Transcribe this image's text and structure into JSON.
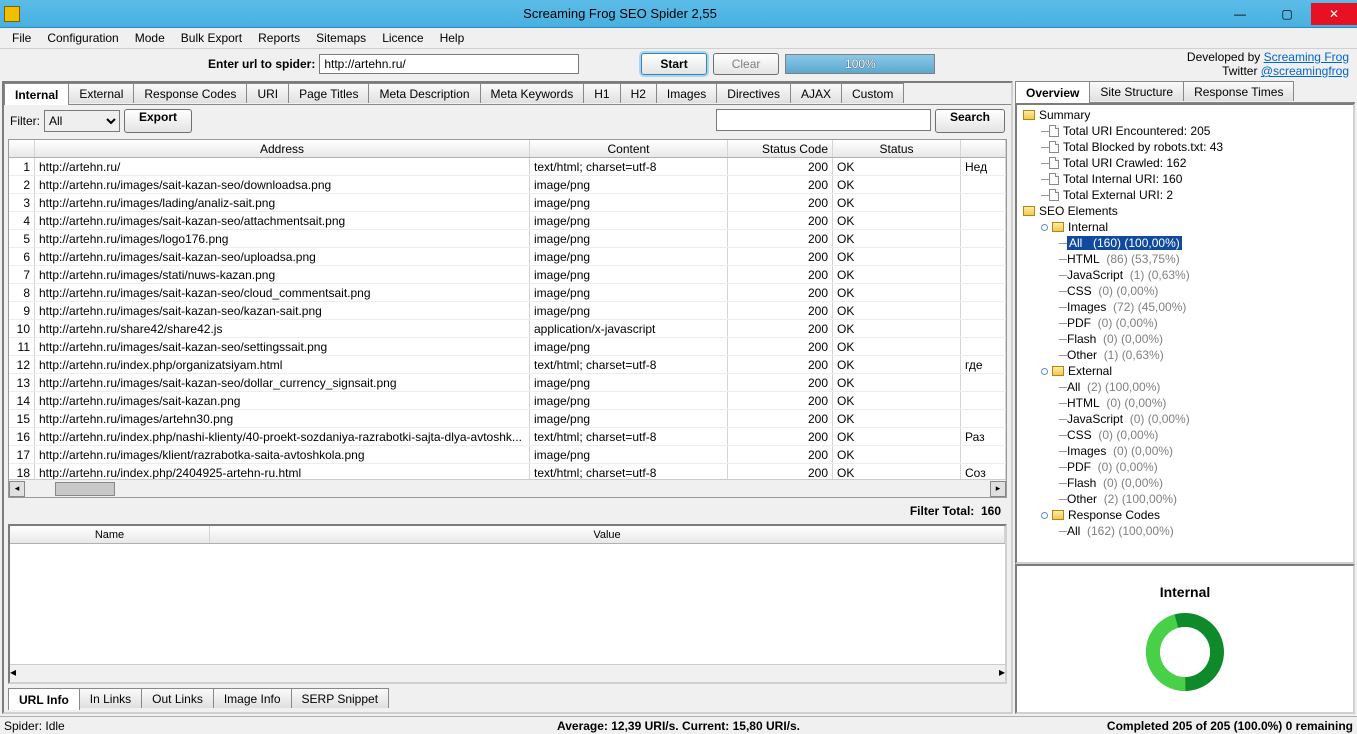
{
  "window": {
    "title": "Screaming Frog SEO Spider 2,55"
  },
  "menu": [
    "File",
    "Configuration",
    "Mode",
    "Bulk Export",
    "Reports",
    "Sitemaps",
    "Licence",
    "Help"
  ],
  "urlbar": {
    "label": "Enter url to spider:",
    "value": "http://artehn.ru/",
    "start": "Start",
    "clear": "Clear",
    "progress": "100%"
  },
  "credits": {
    "line1_prefix": "Developed by ",
    "line1_link": "Screaming Frog",
    "line2_prefix": "Twitter ",
    "line2_link": "@screamingfrog"
  },
  "main_tabs": [
    "Internal",
    "External",
    "Response Codes",
    "URI",
    "Page Titles",
    "Meta Description",
    "Meta Keywords",
    "H1",
    "H2",
    "Images",
    "Directives",
    "AJAX",
    "Custom"
  ],
  "filter": {
    "label": "Filter:",
    "value": "All",
    "export": "Export",
    "search": "Search"
  },
  "table": {
    "headers": [
      "",
      "Address",
      "Content",
      "Status Code",
      "Status",
      ""
    ],
    "rows": [
      {
        "n": "1",
        "addr": "http://artehn.ru/",
        "content": "text/html; charset=utf-8",
        "code": "200",
        "status": "OK",
        "extra": "Нед"
      },
      {
        "n": "2",
        "addr": "http://artehn.ru/images/sait-kazan-seo/downloadsa.png",
        "content": "image/png",
        "code": "200",
        "status": "OK",
        "extra": ""
      },
      {
        "n": "3",
        "addr": "http://artehn.ru/images/lading/analiz-sait.png",
        "content": "image/png",
        "code": "200",
        "status": "OK",
        "extra": ""
      },
      {
        "n": "4",
        "addr": "http://artehn.ru/images/sait-kazan-seo/attachmentsait.png",
        "content": "image/png",
        "code": "200",
        "status": "OK",
        "extra": ""
      },
      {
        "n": "5",
        "addr": "http://artehn.ru/images/logo176.png",
        "content": "image/png",
        "code": "200",
        "status": "OK",
        "extra": ""
      },
      {
        "n": "6",
        "addr": "http://artehn.ru/images/sait-kazan-seo/uploadsa.png",
        "content": "image/png",
        "code": "200",
        "status": "OK",
        "extra": ""
      },
      {
        "n": "7",
        "addr": "http://artehn.ru/images/stati/nuws-kazan.png",
        "content": "image/png",
        "code": "200",
        "status": "OK",
        "extra": ""
      },
      {
        "n": "8",
        "addr": "http://artehn.ru/images/sait-kazan-seo/cloud_commentsait.png",
        "content": "image/png",
        "code": "200",
        "status": "OK",
        "extra": ""
      },
      {
        "n": "9",
        "addr": "http://artehn.ru/images/sait-kazan-seo/kazan-sait.png",
        "content": "image/png",
        "code": "200",
        "status": "OK",
        "extra": ""
      },
      {
        "n": "10",
        "addr": "http://artehn.ru/share42/share42.js",
        "content": "application/x-javascript",
        "code": "200",
        "status": "OK",
        "extra": ""
      },
      {
        "n": "11",
        "addr": "http://artehn.ru/images/sait-kazan-seo/settingssait.png",
        "content": "image/png",
        "code": "200",
        "status": "OK",
        "extra": ""
      },
      {
        "n": "12",
        "addr": "http://artehn.ru/index.php/organizatsiyam.html",
        "content": "text/html; charset=utf-8",
        "code": "200",
        "status": "OK",
        "extra": "где"
      },
      {
        "n": "13",
        "addr": "http://artehn.ru/images/sait-kazan-seo/dollar_currency_signsait.png",
        "content": "image/png",
        "code": "200",
        "status": "OK",
        "extra": ""
      },
      {
        "n": "14",
        "addr": "http://artehn.ru/images/sait-kazan.png",
        "content": "image/png",
        "code": "200",
        "status": "OK",
        "extra": ""
      },
      {
        "n": "15",
        "addr": "http://artehn.ru/images/artehn30.png",
        "content": "image/png",
        "code": "200",
        "status": "OK",
        "extra": ""
      },
      {
        "n": "16",
        "addr": "http://artehn.ru/index.php/nashi-klienty/40-proekt-sozdaniya-razrabotki-sajta-dlya-avtoshk...",
        "content": "text/html; charset=utf-8",
        "code": "200",
        "status": "OK",
        "extra": "Раз"
      },
      {
        "n": "17",
        "addr": "http://artehn.ru/images/klient/razrabotka-saita-avtoshkola.png",
        "content": "image/png",
        "code": "200",
        "status": "OK",
        "extra": ""
      },
      {
        "n": "18",
        "addr": "http://artehn.ru/index.php/2404925-artehn-ru.html",
        "content": "text/html; charset=utf-8",
        "code": "200",
        "status": "OK",
        "extra": "Соз"
      }
    ]
  },
  "filter_total_label": "Filter Total:",
  "filter_total_value": "160",
  "detail": {
    "cols": [
      "Name",
      "Value"
    ],
    "tabs": [
      "URL Info",
      "In Links",
      "Out Links",
      "Image Info",
      "SERP Snippet"
    ]
  },
  "right_tabs": [
    "Overview",
    "Site Structure",
    "Response Times"
  ],
  "tree": {
    "summary_label": "Summary",
    "summary_items": [
      "Total URI Encountered: 205",
      "Total Blocked by robots.txt: 43",
      "Total URI Crawled: 162",
      "Total Internal URI: 160",
      "Total External URI: 2"
    ],
    "seo_label": "SEO Elements",
    "internal_label": "Internal",
    "internal_items": [
      {
        "main": "All",
        "extra": "(160) (100,00%)",
        "selected": true
      },
      {
        "main": "HTML",
        "extra": "(86) (53,75%)"
      },
      {
        "main": "JavaScript",
        "extra": "(1) (0,63%)"
      },
      {
        "main": "CSS",
        "extra": "(0) (0,00%)"
      },
      {
        "main": "Images",
        "extra": "(72) (45,00%)"
      },
      {
        "main": "PDF",
        "extra": "(0) (0,00%)"
      },
      {
        "main": "Flash",
        "extra": "(0) (0,00%)"
      },
      {
        "main": "Other",
        "extra": "(1) (0,63%)"
      }
    ],
    "external_label": "External",
    "external_items": [
      {
        "main": "All",
        "extra": "(2) (100,00%)"
      },
      {
        "main": "HTML",
        "extra": "(0) (0,00%)"
      },
      {
        "main": "JavaScript",
        "extra": "(0) (0,00%)"
      },
      {
        "main": "CSS",
        "extra": "(0) (0,00%)"
      },
      {
        "main": "Images",
        "extra": "(0) (0,00%)"
      },
      {
        "main": "PDF",
        "extra": "(0) (0,00%)"
      },
      {
        "main": "Flash",
        "extra": "(0) (0,00%)"
      },
      {
        "main": "Other",
        "extra": "(2) (100,00%)"
      }
    ],
    "response_label": "Response Codes",
    "response_first": {
      "main": "All",
      "extra": "(162) (100,00%)"
    }
  },
  "chart": {
    "title": "Internal"
  },
  "chart_data": {
    "type": "pie",
    "title": "Internal",
    "series": [
      {
        "name": "HTML",
        "value": 86
      },
      {
        "name": "JavaScript",
        "value": 1
      },
      {
        "name": "CSS",
        "value": 0
      },
      {
        "name": "Images",
        "value": 72
      },
      {
        "name": "PDF",
        "value": 0
      },
      {
        "name": "Flash",
        "value": 0
      },
      {
        "name": "Other",
        "value": 1
      }
    ],
    "total": 160
  },
  "status": {
    "left": "Spider: Idle",
    "center": "Average: 12,39 URI/s. Current: 15,80 URI/s.",
    "right": "Completed 205 of 205 (100.0%) 0 remaining"
  }
}
